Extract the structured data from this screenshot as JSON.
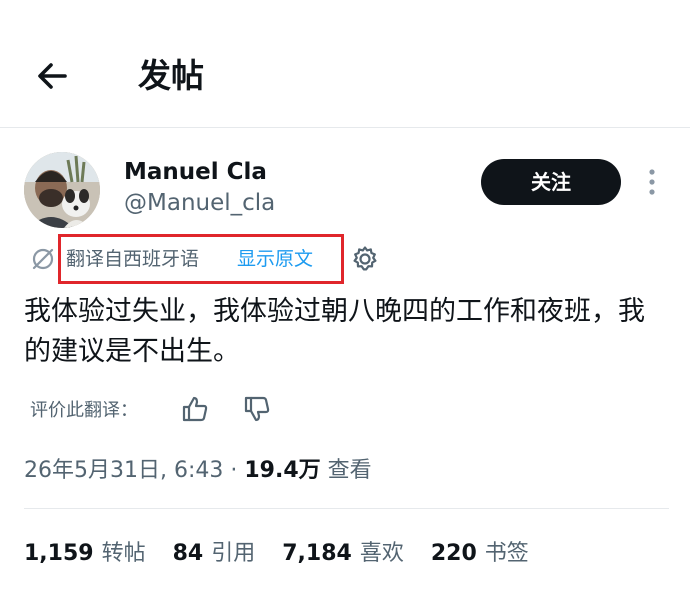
{
  "header": {
    "back_icon": "arrow-left-icon",
    "title": "发帖"
  },
  "author": {
    "name": "Manuel Cla",
    "handle": "@Manuel_cla",
    "follow_label": "关注",
    "more_icon": "more-vertical-icon"
  },
  "translation": {
    "globe_icon": "globe-slash-icon",
    "label": "翻译自西班牙语",
    "show_original": "显示原文",
    "settings_icon": "gear-icon",
    "highlight_color": "#e0262b"
  },
  "tweet": {
    "text": "我体验过失业，我体验过朝八晚四的工作和夜班，我的建议是不出生。"
  },
  "rating": {
    "label": "评价此翻译：",
    "up_icon": "thumbs-up-icon",
    "down_icon": "thumbs-down-icon"
  },
  "meta": {
    "timestamp": "26年5月31日, 6:43 · ",
    "views_count": "19.4万",
    "views_label": " 查看"
  },
  "stats": [
    {
      "num": "1,159",
      "label": "转帖"
    },
    {
      "num": "84",
      "label": "引用"
    },
    {
      "num": "7,184",
      "label": "喜欢"
    },
    {
      "num": "220",
      "label": "书签"
    }
  ],
  "colors": {
    "text": "#0f1419",
    "secondary": "#536471",
    "link": "#1d9bf0",
    "button_bg": "#0f1419"
  }
}
